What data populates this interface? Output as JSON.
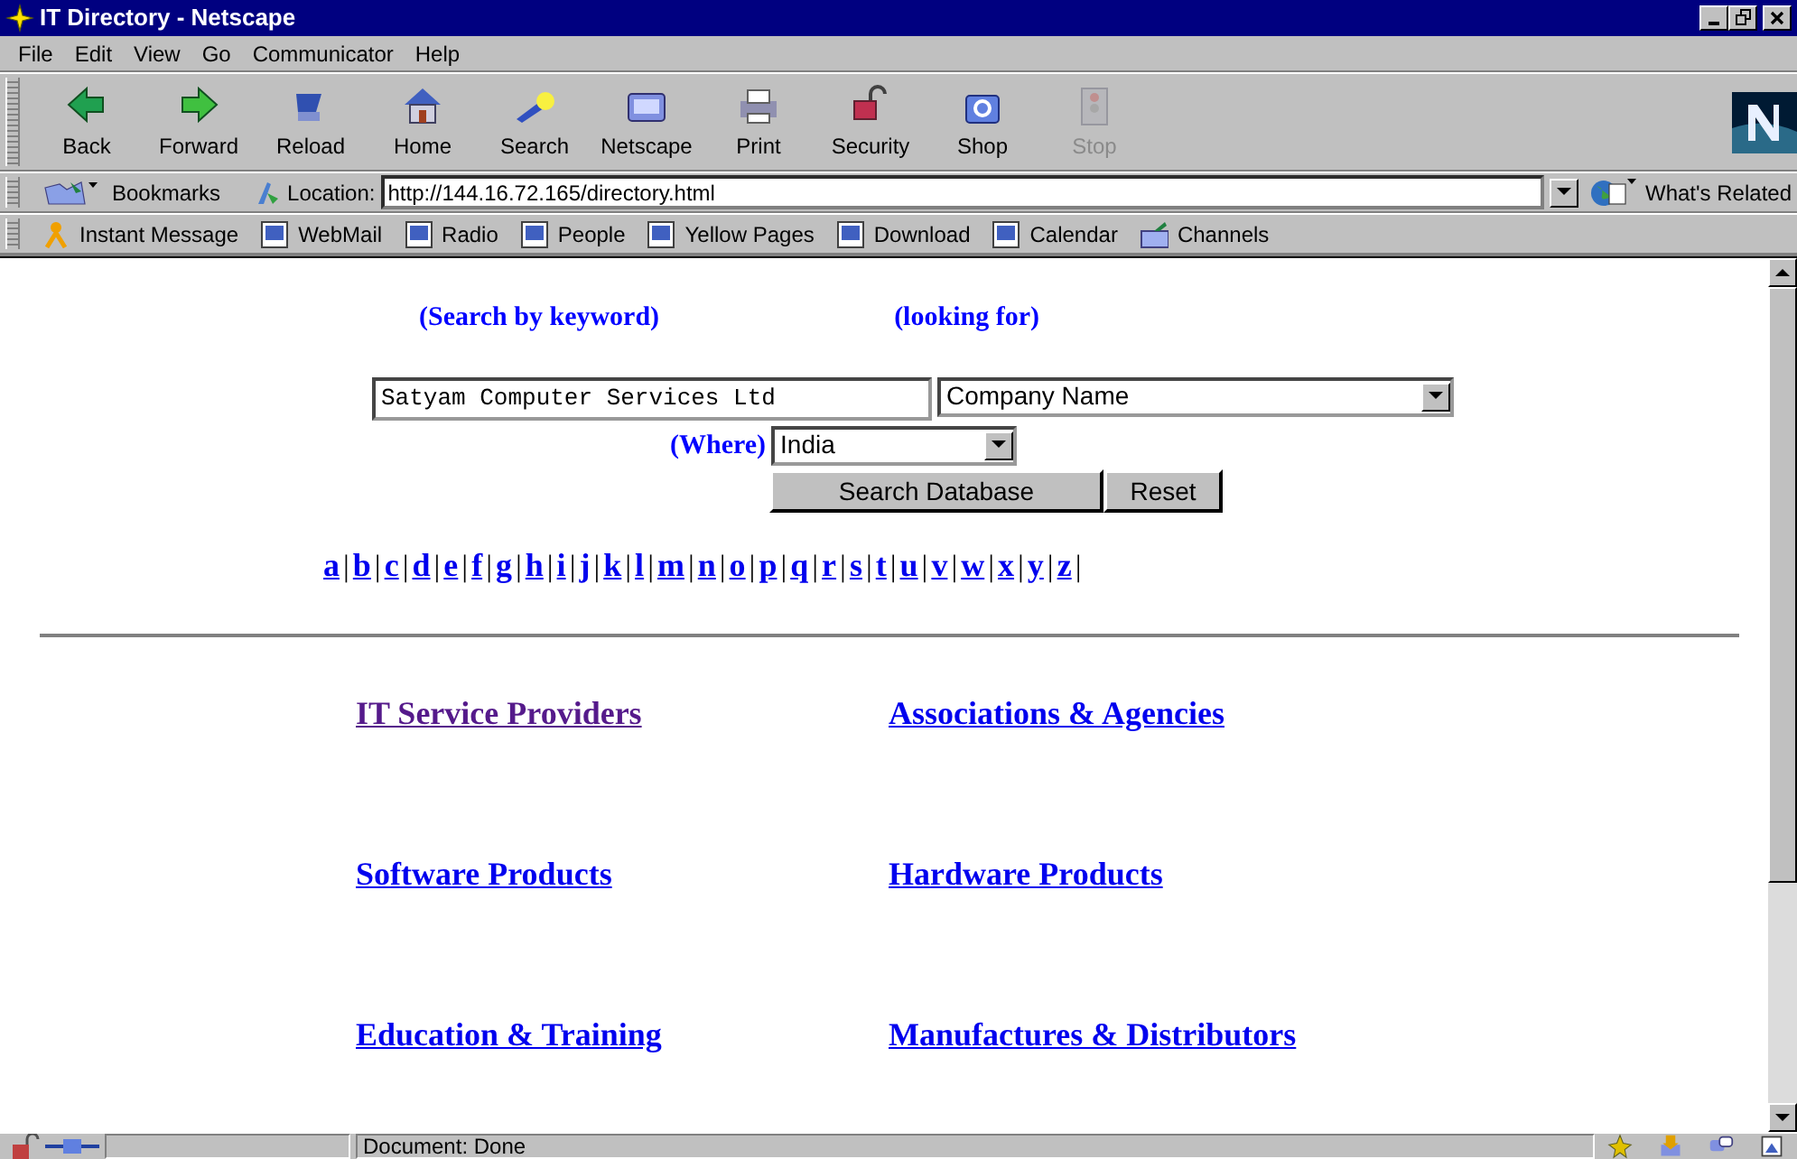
{
  "window": {
    "title": "IT Directory - Netscape"
  },
  "menu": [
    "File",
    "Edit",
    "View",
    "Go",
    "Communicator",
    "Help"
  ],
  "toolbar": [
    {
      "label": "Back",
      "kind": "back",
      "disabled": false
    },
    {
      "label": "Forward",
      "kind": "forward",
      "disabled": false
    },
    {
      "label": "Reload",
      "kind": "reload",
      "disabled": false
    },
    {
      "label": "Home",
      "kind": "home",
      "disabled": false
    },
    {
      "label": "Search",
      "kind": "search",
      "disabled": false
    },
    {
      "label": "Netscape",
      "kind": "netscape",
      "disabled": false
    },
    {
      "label": "Print",
      "kind": "print",
      "disabled": false
    },
    {
      "label": "Security",
      "kind": "security",
      "disabled": false
    },
    {
      "label": "Shop",
      "kind": "shop",
      "disabled": false
    },
    {
      "label": "Stop",
      "kind": "stop",
      "disabled": true
    }
  ],
  "location_bar": {
    "bookmarks": "Bookmarks",
    "location_label": "Location:",
    "url": "http://144.16.72.165/directory.html",
    "related": "What's Related"
  },
  "personal_toolbar": [
    {
      "label": "Instant Message",
      "kind": "person"
    },
    {
      "label": "WebMail",
      "kind": "page"
    },
    {
      "label": "Radio",
      "kind": "page"
    },
    {
      "label": "People",
      "kind": "page"
    },
    {
      "label": "Yellow Pages",
      "kind": "page"
    },
    {
      "label": "Download",
      "kind": "page"
    },
    {
      "label": "Calendar",
      "kind": "page"
    },
    {
      "label": "Channels",
      "kind": "channels"
    }
  ],
  "search_form": {
    "keyword_heading": "(Search by keyword)",
    "looking_for_heading": "(looking for)",
    "keyword": "Satyam Computer Services Ltd",
    "looking_for": "Company Name",
    "where_label": "(Where)",
    "where": "India",
    "submit": "Search Database",
    "reset": "Reset"
  },
  "alphabet": {
    "separator": "|",
    "letters": [
      "a",
      "b",
      "c",
      "d",
      "e",
      "f",
      "g",
      "h",
      "i",
      "j",
      "k",
      "l",
      "m",
      "n",
      "o",
      "p",
      "q",
      "r",
      "s",
      "t",
      "u",
      "v",
      "w",
      "x",
      "y",
      "z"
    ]
  },
  "categories": [
    {
      "label": "IT Service Providers",
      "visited": true
    },
    {
      "label": "Associations & Agencies",
      "visited": false
    },
    {
      "label": "Software Products ",
      "visited": false
    },
    {
      "label": "Hardware Products",
      "visited": false
    },
    {
      "label": "Education & Training",
      "visited": false
    },
    {
      "label": "Manufactures & Distributors",
      "visited": false
    }
  ],
  "status_bar": {
    "message": "Document: Done"
  }
}
